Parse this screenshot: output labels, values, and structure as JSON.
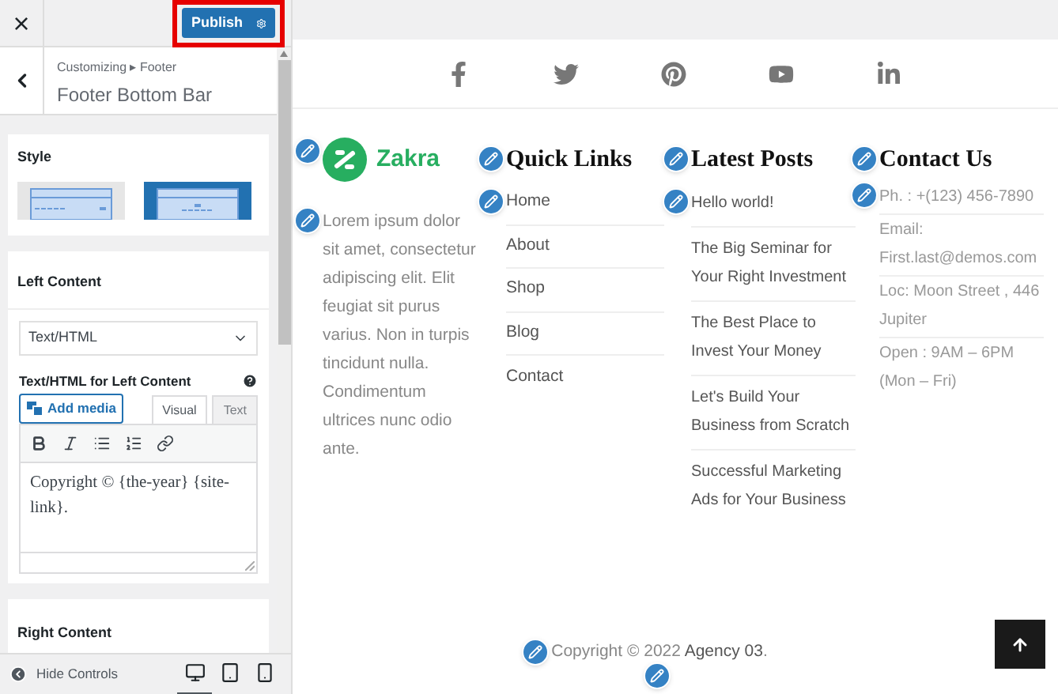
{
  "top_bar": {
    "close": "×",
    "publish": "Publish"
  },
  "header": {
    "breadcrumb": "Customizing ▸ Footer",
    "title": "Footer Bottom Bar"
  },
  "style_section": {
    "label": "Style",
    "options": [
      {
        "kind": "left",
        "selected": false
      },
      {
        "kind": "center",
        "selected": true
      }
    ]
  },
  "left_content": {
    "label": "Left Content",
    "select_value": "Text/HTML",
    "editor_label": "Text/HTML for Left Content",
    "add_media": "Add media",
    "tabs": [
      {
        "label": "Visual",
        "selected": true
      },
      {
        "label": "Text",
        "selected": false
      }
    ],
    "editor_text": "Copyright © {the-year} {site-link}."
  },
  "right_content": {
    "label": "Right Content"
  },
  "bottom_bar": {
    "hide_controls": "Hide Controls",
    "devices": [
      {
        "kind": "desktop",
        "selected": true
      },
      {
        "kind": "tablet",
        "selected": false
      },
      {
        "kind": "mobile",
        "selected": false
      }
    ]
  },
  "preview": {
    "social": [
      {
        "kind": "facebook"
      },
      {
        "kind": "twitter"
      },
      {
        "kind": "pinterest"
      },
      {
        "kind": "youtube"
      },
      {
        "kind": "linkedin"
      }
    ],
    "about": {
      "logo_text": "Zakra",
      "description": "Lorem ipsum dolor sit amet, consectetur adipiscing elit. Elit feugiat sit purus varius. Non in turpis tincidunt nulla. Condimentum ultrices nunc odio ante."
    },
    "quick_links": {
      "title": "Quick Links",
      "items": [
        "Home",
        "About",
        "Shop",
        "Blog",
        "Contact"
      ]
    },
    "latest_posts": {
      "title": "Latest Posts",
      "items": [
        "Hello world!",
        "The Big Seminar for Your Right Investment",
        "The Best Place to Invest Your Money",
        "Let's Build Your Business from Scratch",
        "Successful Marketing Ads for Your Business"
      ]
    },
    "contact": {
      "title": "Contact Us",
      "items": [
        "Ph. : +(123) 456-7890",
        "Email: First.last@demos.com",
        "Loc: Moon Street , 446 Jupiter",
        "Open : 9AM – 6PM (Mon – Fri)"
      ]
    },
    "copyright": {
      "prefix": "Copyright © 2022 ",
      "link": "Agency 03",
      "suffix": "."
    }
  }
}
